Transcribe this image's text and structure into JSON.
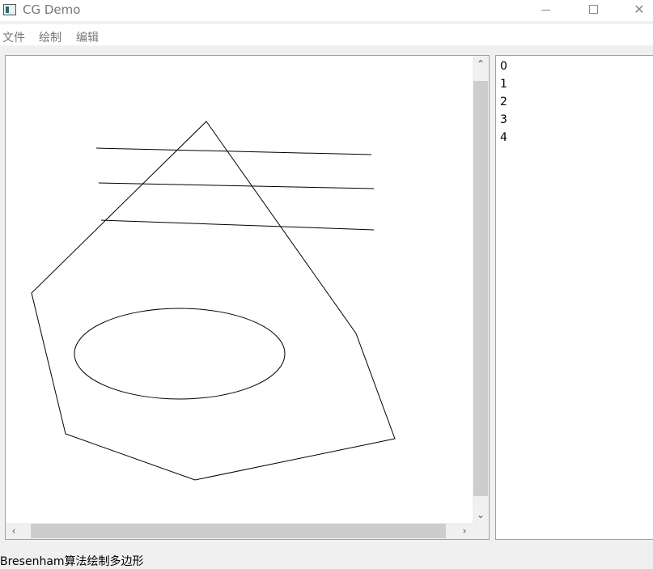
{
  "window": {
    "title": "CG Demo",
    "minimize_glyph": "",
    "maximize_glyph": "",
    "close_glyph": "✕"
  },
  "menu": {
    "items": [
      "文件",
      "绘制",
      "编辑"
    ]
  },
  "canvas": {
    "scroll_up_glyph": "⌃",
    "scroll_down_glyph": "⌄",
    "scroll_left_glyph": "‹",
    "scroll_right_glyph": "›",
    "stroke_color": "#000000",
    "background_color": "#ffffff"
  },
  "item_list": [
    "0",
    "1",
    "2",
    "3",
    "4"
  ],
  "status": {
    "text": "Bresenham算法绘制多边形"
  }
}
